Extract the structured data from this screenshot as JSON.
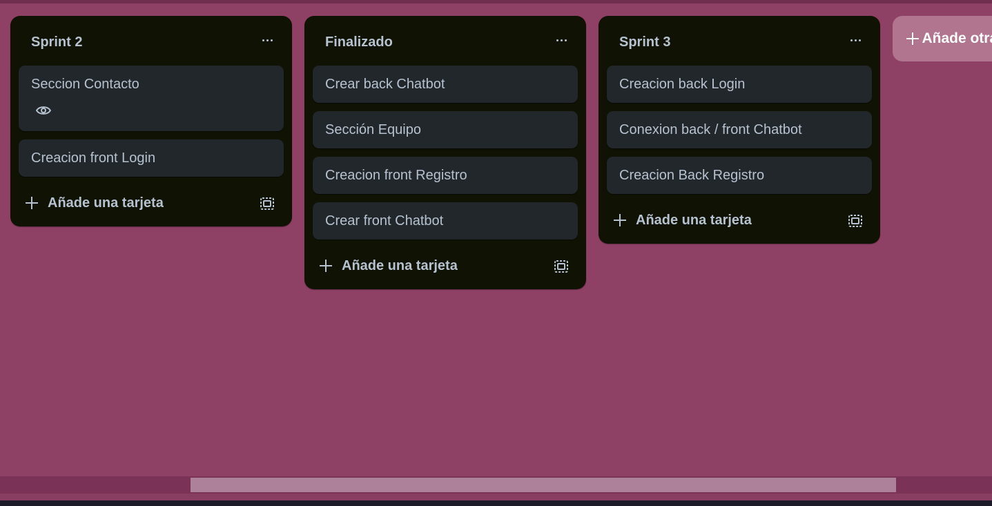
{
  "board": {
    "lists": [
      {
        "title": "Sprint 2",
        "cards": [
          {
            "title": "Seccion Contacto",
            "badge": "eye-icon"
          },
          {
            "title": "Creacion front Login"
          }
        ],
        "add_card_label": "Añade una tarjeta"
      },
      {
        "title": "Finalizado",
        "cards": [
          {
            "title": "Crear back Chatbot"
          },
          {
            "title": "Sección Equipo"
          },
          {
            "title": "Creacion front Registro"
          },
          {
            "title": "Crear front Chatbot"
          }
        ],
        "add_card_label": "Añade una tarjeta"
      },
      {
        "title": "Sprint 3",
        "cards": [
          {
            "title": "Creacion back Login"
          },
          {
            "title": "Conexion back / front Chatbot"
          },
          {
            "title": "Creacion Back Registro"
          }
        ],
        "add_card_label": "Añade una tarjeta"
      }
    ],
    "add_list_label": "Añade otra lista"
  },
  "colors": {
    "board_background": "#8f4065",
    "list_background": "#101204",
    "card_background": "#22272b",
    "text": "#b6c2cf"
  }
}
